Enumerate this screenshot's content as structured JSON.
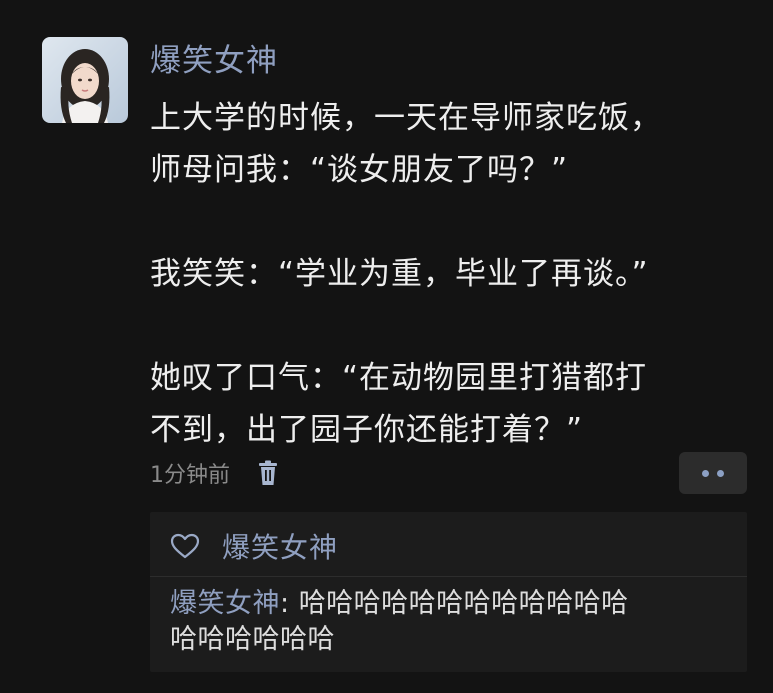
{
  "post": {
    "username": "爆笑女神",
    "content": [
      "上大学的时候，一天在导师家吃饭，",
      "师母问我：“谈女朋友了吗？”",
      "",
      "我笑笑：“学业为重，毕业了再谈。”",
      "",
      "她叹了口气：“在动物园里打猎都打",
      "不到，出了园子你还能打着？”"
    ],
    "timestamp": "1分钟前",
    "icons": {
      "delete": "trash-icon",
      "more": "more-dots-icon",
      "like": "heart-icon"
    }
  },
  "likes": {
    "names": "爆笑女神"
  },
  "comments": [
    {
      "author": "爆笑女神",
      "separator": ": ",
      "text_line1": "哈哈哈哈哈哈哈哈哈哈哈哈",
      "text_line2": "哈哈哈哈哈哈"
    }
  ],
  "colors": {
    "background": "#131313",
    "name_accent": "#8f9fc0",
    "text": "#eeeeee",
    "muted": "#8a8a8a",
    "comment_bg": "#1c1c1c"
  }
}
